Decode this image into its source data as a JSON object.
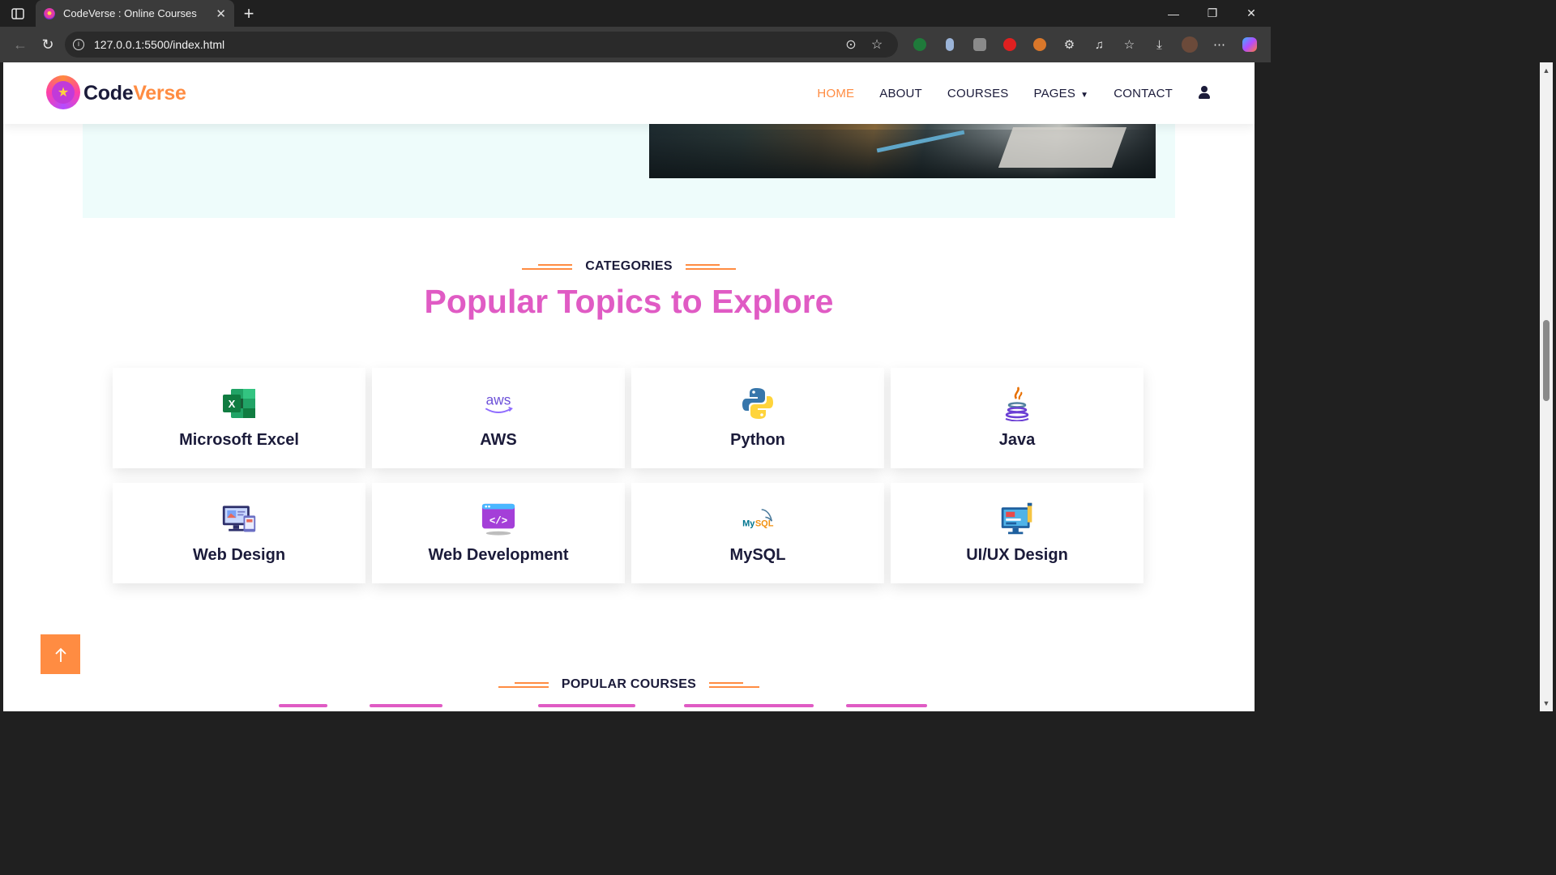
{
  "browser": {
    "tab_title": "CodeVerse : Online Courses",
    "url": "127.0.0.1:5500/index.html"
  },
  "site": {
    "logo_part1": "Code",
    "logo_part2": "Verse",
    "nav": [
      "HOME",
      "ABOUT",
      "COURSES",
      "PAGES",
      "CONTACT"
    ],
    "active_nav": "HOME"
  },
  "categories": {
    "eyebrow": "CATEGORIES",
    "title": "Popular Topics to Explore",
    "items": [
      {
        "label": "Microsoft Excel",
        "icon": "excel-icon"
      },
      {
        "label": "AWS",
        "icon": "aws-icon"
      },
      {
        "label": "Python",
        "icon": "python-icon"
      },
      {
        "label": "Java",
        "icon": "java-icon"
      },
      {
        "label": "Web Design",
        "icon": "web-design-icon"
      },
      {
        "label": "Web Development",
        "icon": "web-development-icon"
      },
      {
        "label": "MySQL",
        "icon": "mysql-icon"
      },
      {
        "label": "UI/UX Design",
        "icon": "uiux-design-icon"
      }
    ]
  },
  "popular_courses": {
    "eyebrow": "POPULAR COURSES"
  },
  "colors": {
    "accent": "#ff8c42",
    "heading": "#e05bc4",
    "navy": "#1b1b3a",
    "hero_bg": "#eefcfb"
  }
}
